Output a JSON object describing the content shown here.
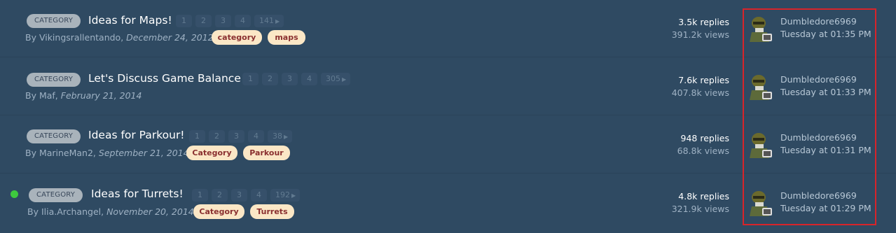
{
  "threads": [
    {
      "category": "CATEGORY",
      "title": "Ideas for Maps!",
      "pages": [
        "1",
        "2",
        "3",
        "4",
        "141"
      ],
      "author_prefix": "By Vikingsrallentando,",
      "date": "December 24, 2012",
      "tags": [
        "category",
        "maps"
      ],
      "replies": "3.5k replies",
      "views": "391.2k views",
      "last_user": "Dumbledore6969",
      "last_time": "Tuesday at 01:35 PM",
      "unread": false
    },
    {
      "category": "CATEGORY",
      "title": "Let's Discuss Game Balance",
      "pages": [
        "1",
        "2",
        "3",
        "4",
        "305"
      ],
      "author_prefix": "By Maf,",
      "date": "February 21, 2014",
      "tags": [],
      "replies": "7.6k replies",
      "views": "407.8k views",
      "last_user": "Dumbledore6969",
      "last_time": "Tuesday at 01:33 PM",
      "unread": false
    },
    {
      "category": "CATEGORY",
      "title": "Ideas for Parkour!",
      "pages": [
        "1",
        "2",
        "3",
        "4",
        "38"
      ],
      "author_prefix": "By MarineMan2,",
      "date": "September 21, 2014",
      "tags": [
        "Category",
        "Parkour"
      ],
      "replies": "948 replies",
      "views": "68.8k views",
      "last_user": "Dumbledore6969",
      "last_time": "Tuesday at 01:31 PM",
      "unread": false
    },
    {
      "category": "CATEGORY",
      "title": "Ideas for Turrets!",
      "pages": [
        "1",
        "2",
        "3",
        "4",
        "192"
      ],
      "author_prefix": "By Ilia.Archangel,",
      "date": "November 20, 2014",
      "tags": [
        "Category",
        "Turrets"
      ],
      "replies": "4.8k replies",
      "views": "321.9k views",
      "last_user": "Dumbledore6969",
      "last_time": "Tuesday at 01:29 PM",
      "unread": true
    }
  ],
  "colors": {
    "background": "#2f4a62",
    "tag_bg": "#fbe7c6",
    "tag_text": "#8a2f2f",
    "unread_dot": "#3ec93e",
    "highlight": "#d8242a"
  },
  "icons": {
    "page_next": "arrow-right-icon",
    "avatar": "soldier-avatar-icon"
  }
}
